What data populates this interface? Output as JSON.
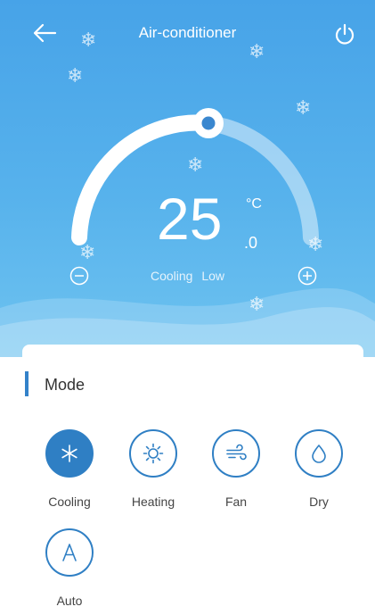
{
  "header": {
    "title": "Air-conditioner"
  },
  "icons": {
    "back": "back-arrow-icon",
    "power": "power-icon",
    "snow": "snowflake-icon"
  },
  "temperature": {
    "value": "25",
    "decimal": ".0",
    "unit": "°C"
  },
  "status": {
    "mode": "Cooling",
    "fan_speed": "Low"
  },
  "mode_panel": {
    "title": "Mode",
    "items": [
      {
        "label": "Cooling",
        "icon": "snowflake-icon",
        "selected": true
      },
      {
        "label": "Heating",
        "icon": "sun-icon",
        "selected": false
      },
      {
        "label": "Fan",
        "icon": "wind-icon",
        "selected": false
      },
      {
        "label": "Dry",
        "icon": "droplet-icon",
        "selected": false
      },
      {
        "label": "Auto",
        "icon": "auto-letter-icon",
        "selected": false
      }
    ]
  },
  "colors": {
    "accent": "#2f7fc4",
    "sky": "#4ea9eb",
    "white": "#ffffff"
  }
}
